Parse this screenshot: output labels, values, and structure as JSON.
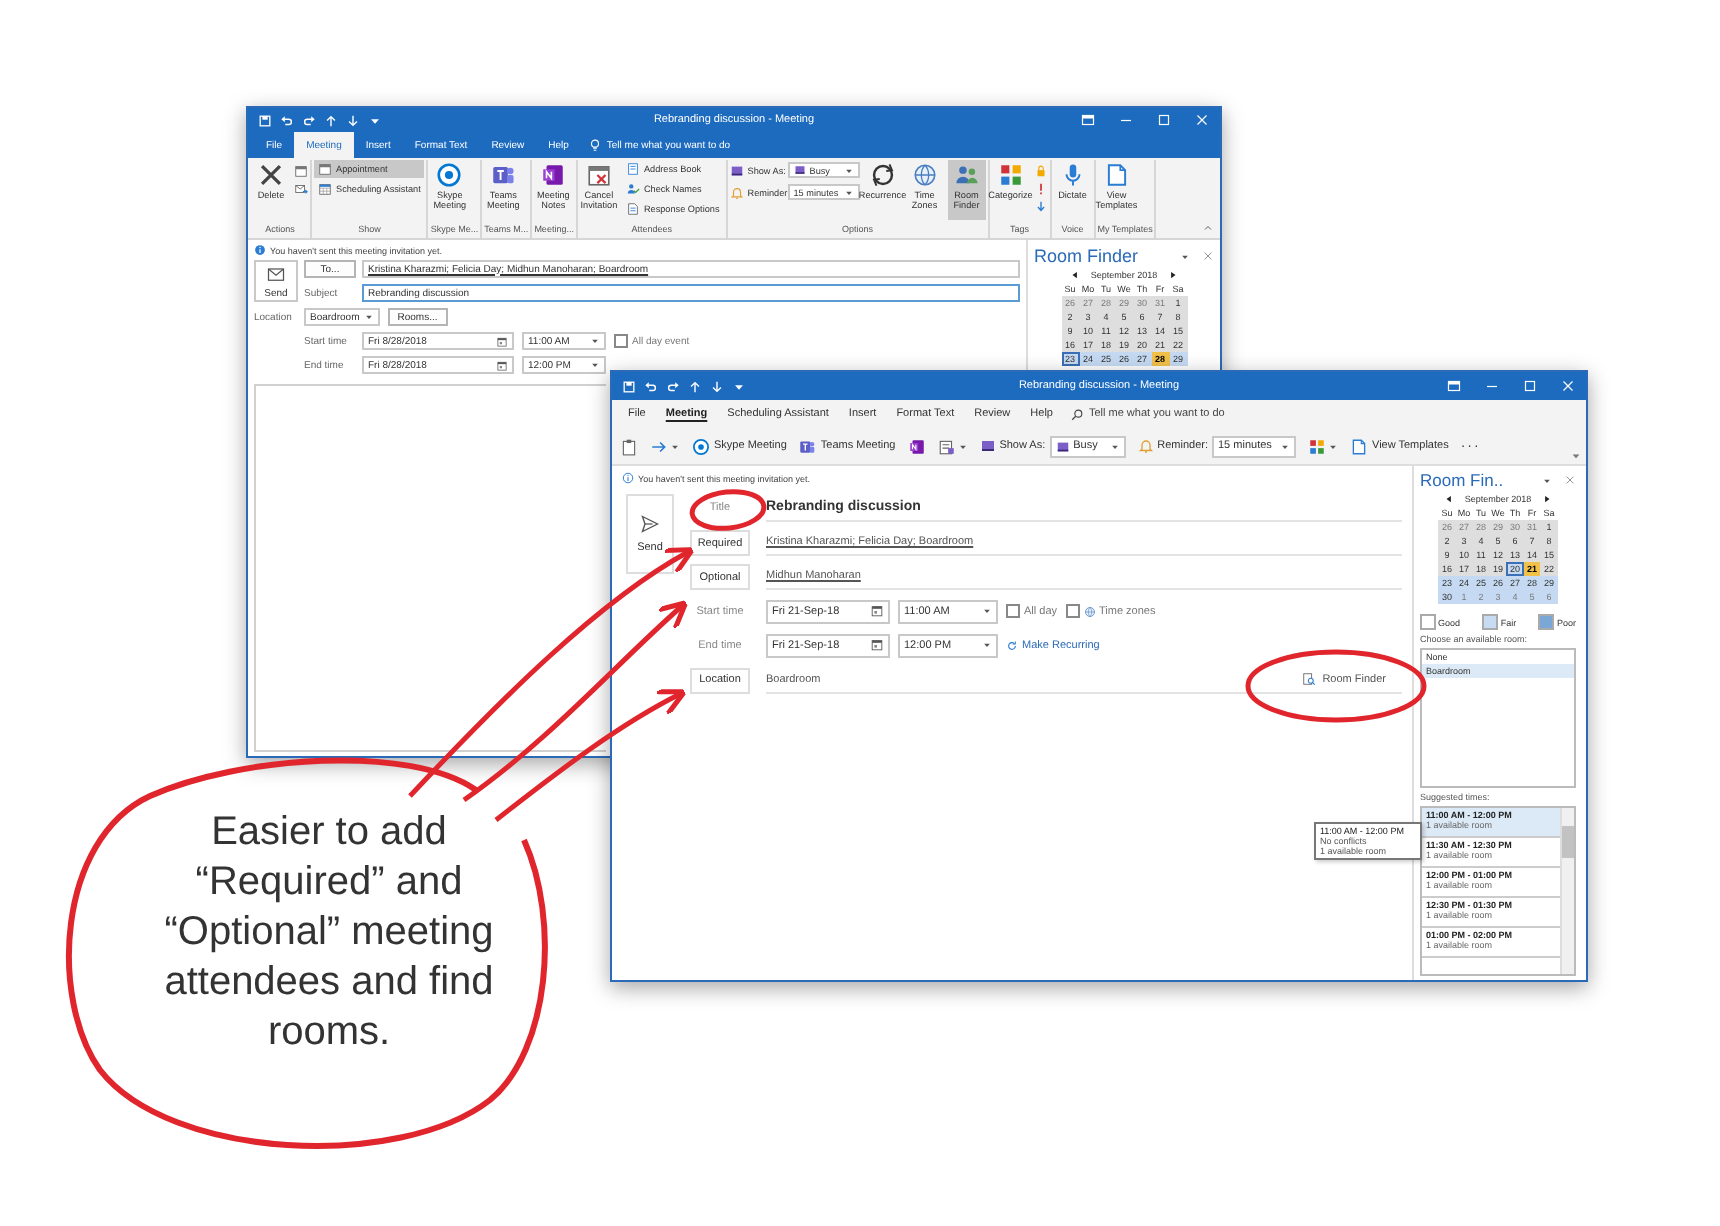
{
  "back_window": {
    "title": "Rebranding discussion - Meeting",
    "tabs": [
      {
        "label": "File",
        "selected": false
      },
      {
        "label": "Meeting",
        "selected": true
      },
      {
        "label": "Insert",
        "selected": false
      },
      {
        "label": "Format Text",
        "selected": false
      },
      {
        "label": "Review",
        "selected": false
      },
      {
        "label": "Help",
        "selected": false
      }
    ],
    "tell_me": "Tell me what you want to do",
    "ribbon": [
      {
        "label": "Actions",
        "items": [
          {
            "kind": "large",
            "label": "Delete",
            "on": false
          }
        ]
      },
      {
        "label": "Show",
        "items": [
          {
            "kind": "small",
            "label": "Appointment",
            "on": true
          },
          {
            "kind": "small",
            "label": "Scheduling Assistant",
            "on": false
          }
        ]
      },
      {
        "label": "Skype Me...",
        "items": [
          {
            "kind": "large",
            "label": "Skype Meeting",
            "on": false
          }
        ]
      },
      {
        "label": "Teams M...",
        "items": [
          {
            "kind": "large",
            "label": "Teams Meeting",
            "on": false
          }
        ]
      },
      {
        "label": "Meeting...",
        "items": [
          {
            "kind": "large",
            "label": "Meeting Notes",
            "on": false
          }
        ]
      },
      {
        "label": "Attendees",
        "items": [
          {
            "kind": "large",
            "label": "Cancel Invitation",
            "on": false
          },
          {
            "kind": "small",
            "label": "Address Book",
            "on": false
          },
          {
            "kind": "small",
            "label": "Check Names",
            "on": false
          },
          {
            "kind": "small",
            "label": "Response Options",
            "on": false
          }
        ]
      },
      {
        "label": "Options",
        "items": [
          {
            "kind": "dropdown",
            "label": "Show As:",
            "value": "Busy"
          },
          {
            "kind": "dropdown",
            "label": "Reminder:",
            "value": "15 minutes"
          },
          {
            "kind": "large",
            "label": "Recurrence",
            "on": false
          },
          {
            "kind": "large",
            "label": "Time Zones",
            "on": false
          },
          {
            "kind": "large",
            "label": "Room Finder",
            "on": true
          }
        ]
      },
      {
        "label": "Tags",
        "items": [
          {
            "kind": "large",
            "label": "Categorize",
            "on": false
          }
        ]
      },
      {
        "label": "Voice",
        "items": [
          {
            "kind": "large",
            "label": "Dictate",
            "on": false
          }
        ]
      },
      {
        "label": "My Templates",
        "items": [
          {
            "kind": "large",
            "label": "View Templates",
            "on": false
          }
        ]
      }
    ],
    "info": "You haven't sent this meeting invitation yet.",
    "send": "Send",
    "to_button": "To...",
    "to_value": "Kristina Kharazmi; Felicia Day; Midhun Manoharan; Boardroom",
    "subject_label": "Subject",
    "subject_value": "Rebranding discussion",
    "location_label": "Location",
    "location_value": "Boardroom",
    "rooms_button": "Rooms...",
    "start_label": "Start time",
    "start_date": "Fri 8/28/2018",
    "start_time": "11:00 AM",
    "all_day": {
      "label": "All day event",
      "checked": false
    },
    "end_label": "End time",
    "end_date": "Fri 8/28/2018",
    "end_time": "12:00 PM",
    "room_finder": {
      "title": "Room Finder",
      "calendar": {
        "month": "September 2018",
        "dow": [
          "Su",
          "Mo",
          "Tu",
          "We",
          "Th",
          "Fr",
          "Sa"
        ],
        "weeks": [
          [
            {
              "d": "26",
              "color": "#dedede",
              "muted": true,
              "today": false,
              "selected": false
            },
            {
              "d": "27",
              "color": "#dedede",
              "muted": true,
              "today": false,
              "selected": false
            },
            {
              "d": "28",
              "color": "#dedede",
              "muted": true,
              "today": false,
              "selected": false
            },
            {
              "d": "29",
              "color": "#dedede",
              "muted": true,
              "today": false,
              "selected": false
            },
            {
              "d": "30",
              "color": "#dedede",
              "muted": true,
              "today": false,
              "selected": false
            },
            {
              "d": "31",
              "color": "#dedede",
              "muted": true,
              "today": false,
              "selected": false
            },
            {
              "d": "1",
              "color": "#dedede",
              "muted": false,
              "today": false,
              "selected": false
            }
          ],
          [
            {
              "d": "2",
              "color": "#dedede",
              "muted": false,
              "today": false,
              "selected": false
            },
            {
              "d": "3",
              "color": "#dedede",
              "muted": false,
              "today": false,
              "selected": false
            },
            {
              "d": "4",
              "color": "#dedede",
              "muted": false,
              "today": false,
              "selected": false
            },
            {
              "d": "5",
              "color": "#dedede",
              "muted": false,
              "today": false,
              "selected": false
            },
            {
              "d": "6",
              "color": "#dedede",
              "muted": false,
              "today": false,
              "selected": false
            },
            {
              "d": "7",
              "color": "#dedede",
              "muted": false,
              "today": false,
              "selected": false
            },
            {
              "d": "8",
              "color": "#dedede",
              "muted": false,
              "today": false,
              "selected": false
            }
          ],
          [
            {
              "d": "9",
              "color": "#dedede",
              "muted": false,
              "today": false,
              "selected": false
            },
            {
              "d": "10",
              "color": "#dedede",
              "muted": false,
              "today": false,
              "selected": false
            },
            {
              "d": "11",
              "color": "#dedede",
              "muted": false,
              "today": false,
              "selected": false
            },
            {
              "d": "12",
              "color": "#dedede",
              "muted": false,
              "today": false,
              "selected": false
            },
            {
              "d": "13",
              "color": "#dedede",
              "muted": false,
              "today": false,
              "selected": false
            },
            {
              "d": "14",
              "color": "#dedede",
              "muted": false,
              "today": false,
              "selected": false
            },
            {
              "d": "15",
              "color": "#dedede",
              "muted": false,
              "today": false,
              "selected": false
            }
          ],
          [
            {
              "d": "16",
              "color": "#dedede",
              "muted": false,
              "today": false,
              "selected": false
            },
            {
              "d": "17",
              "color": "#dedede",
              "muted": false,
              "today": false,
              "selected": false
            },
            {
              "d": "18",
              "color": "#dedede",
              "muted": false,
              "today": false,
              "selected": false
            },
            {
              "d": "19",
              "color": "#dedede",
              "muted": false,
              "today": false,
              "selected": false
            },
            {
              "d": "20",
              "color": "#dedede",
              "muted": false,
              "today": false,
              "selected": false
            },
            {
              "d": "21",
              "color": "#dedede",
              "muted": false,
              "today": false,
              "selected": false
            },
            {
              "d": "22",
              "color": "#dedede",
              "muted": false,
              "today": false,
              "selected": false
            }
          ],
          [
            {
              "d": "23",
              "color": "#c5daf2",
              "muted": false,
              "today": true,
              "selected": false
            },
            {
              "d": "24",
              "color": "#c5daf2",
              "muted": false,
              "today": false,
              "selected": false
            },
            {
              "d": "25",
              "color": "#c5daf2",
              "muted": false,
              "today": false,
              "selected": false
            },
            {
              "d": "26",
              "color": "#c5daf2",
              "muted": false,
              "today": false,
              "selected": false
            },
            {
              "d": "27",
              "color": "#c5daf2",
              "muted": false,
              "today": false,
              "selected": false
            },
            {
              "d": "28",
              "color": "#f2c14a",
              "muted": false,
              "today": false,
              "selected": true
            },
            {
              "d": "29",
              "color": "#c5daf2",
              "muted": false,
              "today": false,
              "selected": false
            }
          ]
        ]
      }
    }
  },
  "front_window": {
    "title": "Rebranding discussion - Meeting",
    "tabs": [
      {
        "label": "File",
        "selected": false
      },
      {
        "label": "Meeting",
        "selected": true
      },
      {
        "label": "Scheduling Assistant",
        "selected": false
      },
      {
        "label": "Insert",
        "selected": false
      },
      {
        "label": "Format Text",
        "selected": false
      },
      {
        "label": "Review",
        "selected": false
      },
      {
        "label": "Help",
        "selected": false
      }
    ],
    "tell_me": "Tell me what you want to do",
    "toolbar": [
      {
        "kind": "icon"
      },
      {
        "kind": "icon_menu"
      },
      {
        "kind": "button",
        "label": "Skype Meeting"
      },
      {
        "kind": "button",
        "label": "Teams Meeting"
      },
      {
        "kind": "icon"
      },
      {
        "kind": "icon_menu"
      },
      {
        "kind": "dropdown",
        "label": "Show As:",
        "value": "Busy"
      },
      {
        "kind": "dropdown",
        "label": "Reminder:",
        "value": "15 minutes"
      },
      {
        "kind": "icon_menu"
      },
      {
        "kind": "button",
        "label": "View Templates"
      },
      {
        "kind": "more",
        "label": "···"
      }
    ],
    "info": "You haven't sent this meeting invitation yet.",
    "send": "Send",
    "title_field": {
      "label": "Title",
      "value": "Rebranding discussion"
    },
    "required": {
      "label": "Required",
      "value": "Kristina Kharazmi; Felicia Day; Boardroom"
    },
    "optional": {
      "label": "Optional",
      "value": "Midhun Manoharan"
    },
    "start": {
      "label": "Start time",
      "date": "Fri 21-Sep-18",
      "time": "11:00 AM"
    },
    "all_day": {
      "label": "All day",
      "checked": false
    },
    "time_zones": {
      "label": "Time zones",
      "checked": false
    },
    "end": {
      "label": "End time",
      "date": "Fri 21-Sep-18",
      "time": "12:00 PM"
    },
    "recurring": "Make Recurring",
    "location": {
      "label": "Location",
      "value": "Boardroom"
    },
    "room_finder_button": "Room Finder",
    "room_finder": {
      "title": "Room Fin..",
      "calendar": {
        "month": "September 2018",
        "dow": [
          "Su",
          "Mo",
          "Tu",
          "We",
          "Th",
          "Fr",
          "Sa"
        ],
        "weeks": [
          [
            {
              "d": "26",
              "color": "#dedede",
              "muted": true,
              "today": false,
              "selected": false
            },
            {
              "d": "27",
              "color": "#dedede",
              "muted": true,
              "today": false,
              "selected": false
            },
            {
              "d": "28",
              "color": "#dedede",
              "muted": true,
              "today": false,
              "selected": false
            },
            {
              "d": "29",
              "color": "#dedede",
              "muted": true,
              "today": false,
              "selected": false
            },
            {
              "d": "30",
              "color": "#dedede",
              "muted": true,
              "today": false,
              "selected": false
            },
            {
              "d": "31",
              "color": "#dedede",
              "muted": true,
              "today": false,
              "selected": false
            },
            {
              "d": "1",
              "color": "#dedede",
              "muted": false,
              "today": false,
              "selected": false
            }
          ],
          [
            {
              "d": "2",
              "color": "#dedede",
              "muted": false,
              "today": false,
              "selected": false
            },
            {
              "d": "3",
              "color": "#dedede",
              "muted": false,
              "today": false,
              "selected": false
            },
            {
              "d": "4",
              "color": "#dedede",
              "muted": false,
              "today": false,
              "selected": false
            },
            {
              "d": "5",
              "color": "#dedede",
              "muted": false,
              "today": false,
              "selected": false
            },
            {
              "d": "6",
              "color": "#dedede",
              "muted": false,
              "today": false,
              "selected": false
            },
            {
              "d": "7",
              "color": "#dedede",
              "muted": false,
              "today": false,
              "selected": false
            },
            {
              "d": "8",
              "color": "#dedede",
              "muted": false,
              "today": false,
              "selected": false
            }
          ],
          [
            {
              "d": "9",
              "color": "#dedede",
              "muted": false,
              "today": false,
              "selected": false
            },
            {
              "d": "10",
              "color": "#dedede",
              "muted": false,
              "today": false,
              "selected": false
            },
            {
              "d": "11",
              "color": "#dedede",
              "muted": false,
              "today": false,
              "selected": false
            },
            {
              "d": "12",
              "color": "#dedede",
              "muted": false,
              "today": false,
              "selected": false
            },
            {
              "d": "13",
              "color": "#dedede",
              "muted": false,
              "today": false,
              "selected": false
            },
            {
              "d": "14",
              "color": "#dedede",
              "muted": false,
              "today": false,
              "selected": false
            },
            {
              "d": "15",
              "color": "#dedede",
              "muted": false,
              "today": false,
              "selected": false
            }
          ],
          [
            {
              "d": "16",
              "color": "#dedede",
              "muted": false,
              "today": false,
              "selected": false
            },
            {
              "d": "17",
              "color": "#dedede",
              "muted": false,
              "today": false,
              "selected": false
            },
            {
              "d": "18",
              "color": "#dedede",
              "muted": false,
              "today": false,
              "selected": false
            },
            {
              "d": "19",
              "color": "#dedede",
              "muted": false,
              "today": false,
              "selected": false
            },
            {
              "d": "20",
              "color": "#c5daf2",
              "muted": false,
              "today": true,
              "selected": false
            },
            {
              "d": "21",
              "color": "#f2c14a",
              "muted": false,
              "today": false,
              "selected": true
            },
            {
              "d": "22",
              "color": "#dedede",
              "muted": false,
              "today": false,
              "selected": false
            }
          ],
          [
            {
              "d": "23",
              "color": "#c5daf2",
              "muted": false,
              "today": false,
              "selected": false
            },
            {
              "d": "24",
              "color": "#c5daf2",
              "muted": false,
              "today": false,
              "selected": false
            },
            {
              "d": "25",
              "color": "#c5daf2",
              "muted": false,
              "today": false,
              "selected": false
            },
            {
              "d": "26",
              "color": "#c5daf2",
              "muted": false,
              "today": false,
              "selected": false
            },
            {
              "d": "27",
              "color": "#c5daf2",
              "muted": false,
              "today": false,
              "selected": false
            },
            {
              "d": "28",
              "color": "#c5daf2",
              "muted": false,
              "today": false,
              "selected": false
            },
            {
              "d": "29",
              "color": "#c5daf2",
              "muted": false,
              "today": false,
              "selected": false
            }
          ],
          [
            {
              "d": "30",
              "color": "#c5daf2",
              "muted": false,
              "today": false,
              "selected": false
            },
            {
              "d": "1",
              "color": "#c5daf2",
              "muted": true,
              "today": false,
              "selected": false
            },
            {
              "d": "2",
              "color": "#c5daf2",
              "muted": true,
              "today": false,
              "selected": false
            },
            {
              "d": "3",
              "color": "#c5daf2",
              "muted": true,
              "today": false,
              "selected": false
            },
            {
              "d": "4",
              "color": "#c5daf2",
              "muted": true,
              "today": false,
              "selected": false
            },
            {
              "d": "5",
              "color": "#c5daf2",
              "muted": true,
              "today": false,
              "selected": false
            },
            {
              "d": "6",
              "color": "#c5daf2",
              "muted": true,
              "today": false,
              "selected": false
            }
          ]
        ]
      },
      "legend": [
        {
          "label": "Good",
          "color": "#ffffff"
        },
        {
          "label": "Fair",
          "color": "#c7dcf3"
        },
        {
          "label": "Poor",
          "color": "#7ba7d7"
        }
      ],
      "rooms_label": "Choose an available room:",
      "rooms": [
        {
          "label": "None",
          "selected": false
        },
        {
          "label": "Boardroom",
          "selected": true
        }
      ],
      "times_label": "Suggested times:",
      "times": [
        {
          "time": "11:00 AM - 12:00 PM",
          "detail": "1 available room",
          "selected": true
        },
        {
          "time": "11:30 AM - 12:30 PM",
          "detail": "1 available room",
          "selected": false
        },
        {
          "time": "12:00 PM - 01:00 PM",
          "detail": "1 available room",
          "selected": false
        },
        {
          "time": "12:30 PM - 01:30 PM",
          "detail": "1 available room",
          "selected": false
        },
        {
          "time": "01:00 PM - 02:00 PM",
          "detail": "1 available room",
          "selected": false
        }
      ]
    }
  },
  "tooltip": {
    "lines": [
      "11:00 AM - 12:00 PM",
      "No conflicts",
      "1 available room"
    ]
  },
  "annotation": {
    "text": "Easier to add “Required” and “Optional” meeting attendees and find rooms."
  }
}
